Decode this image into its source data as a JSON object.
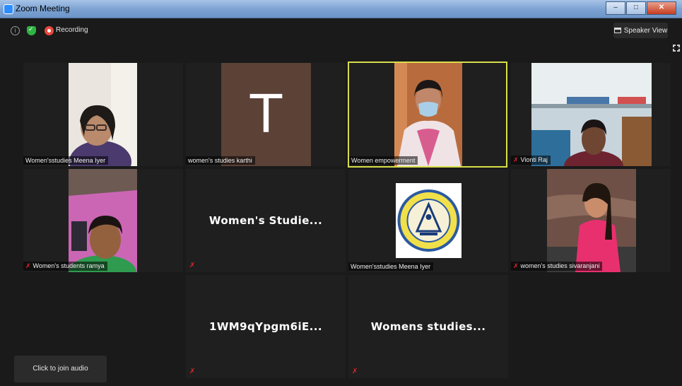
{
  "window": {
    "title": "Zoom Meeting",
    "min": "–",
    "max": "□",
    "close": "✕"
  },
  "toolbar": {
    "info": "i",
    "recording": "Recording",
    "speaker_view": "Speaker View"
  },
  "mic_glyph": "✗",
  "tiles": [
    {
      "name": "Women'sstudies Meena Iyer"
    },
    {
      "name": "women's studies karthi",
      "initial": "T"
    },
    {
      "name": "Women empowerment"
    },
    {
      "name": "Vionti Raj"
    },
    {
      "name": "Women's students ramya"
    },
    {
      "display_name": "Women's  Studie..."
    },
    {
      "name": "Women'sstudies Meena Iyer"
    },
    {
      "name": "women's studies sivaranjani"
    },
    {
      "display_name": "1WM9qYpgm6iE..."
    },
    {
      "display_name": "Womens  studies..."
    }
  ],
  "join_audio": "Click to join audio",
  "colors": {
    "active_speaker": "#d8de4a",
    "muted": "#e0242a",
    "recording": "#e8483b"
  }
}
